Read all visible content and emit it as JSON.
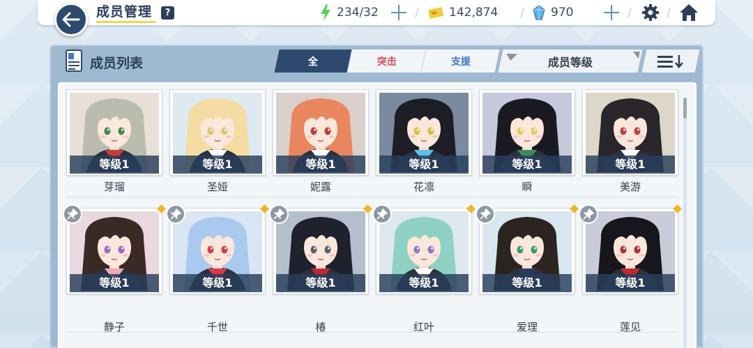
{
  "header": {
    "title": "成员管理",
    "help_label": "?",
    "resources": {
      "stamina": "234/32",
      "credits": "142,874",
      "gems": "970"
    }
  },
  "panel": {
    "title": "成员列表",
    "filters": [
      "全",
      "突击",
      "支援"
    ],
    "active_filter": "全",
    "sort_label": "成员等级"
  },
  "members": [
    {
      "name": "芽瑠",
      "level": "等级1",
      "hair": "#b9bcae",
      "bg": "#e8dfd6",
      "accent": "#c93a3a",
      "eyes": "#3d8c4a",
      "pinned": false
    },
    {
      "name": "圣娅",
      "level": "等级1",
      "hair": "#f4dca3",
      "bg": "#dfe9f2",
      "accent": "#ffffff",
      "eyes": "#e0c56a",
      "pinned": false
    },
    {
      "name": "妮露",
      "level": "等级1",
      "hair": "#e9865f",
      "bg": "#d9d0cc",
      "accent": "#ffffff",
      "eyes": "#c23b33",
      "pinned": false
    },
    {
      "name": "花凛",
      "level": "等级1",
      "hair": "#1d1d26",
      "bg": "#7a8aa0",
      "accent": "#58c2e8",
      "eyes": "#d8c23a",
      "pinned": false
    },
    {
      "name": "瞬",
      "level": "等级1",
      "hair": "#1a1a22",
      "bg": "#c6c9dc",
      "accent": "#3b8c5a",
      "eyes": "#e0d05a",
      "pinned": false
    },
    {
      "name": "美游",
      "level": "等级1",
      "hair": "#2a262c",
      "bg": "#dcd7c8",
      "accent": "#ffffff",
      "eyes": "#c23b43",
      "pinned": false
    },
    {
      "name": "静子",
      "level": "等级1",
      "hair": "#3a2a26",
      "bg": "#e9d9de",
      "accent": "#f2a8b8",
      "eyes": "#9a68c4",
      "pinned": true
    },
    {
      "name": "千世",
      "level": "等级1",
      "hair": "#a9c9ef",
      "bg": "#dbe6f4",
      "accent": "#d83a4a",
      "eyes": "#d83a4a",
      "pinned": true
    },
    {
      "name": "椿",
      "level": "等级1",
      "hair": "#1f222c",
      "bg": "#b4bfce",
      "accent": "#c22a33",
      "eyes": "#5a6070",
      "pinned": true
    },
    {
      "name": "红叶",
      "level": "等级1",
      "hair": "#8fd1c2",
      "bg": "#dde8ef",
      "accent": "#ffffff",
      "eyes": "#8a7ac9",
      "pinned": true
    },
    {
      "name": "爱理",
      "level": "等级1",
      "hair": "#2b2420",
      "bg": "#d8e6f0",
      "accent": "#2a3a5c",
      "eyes": "#3a9a6a",
      "pinned": true
    },
    {
      "name": "莲见",
      "level": "等级1",
      "hair": "#16161c",
      "bg": "#c9ccd8",
      "accent": "#c22a33",
      "eyes": "#b0303a",
      "pinned": true
    }
  ]
}
